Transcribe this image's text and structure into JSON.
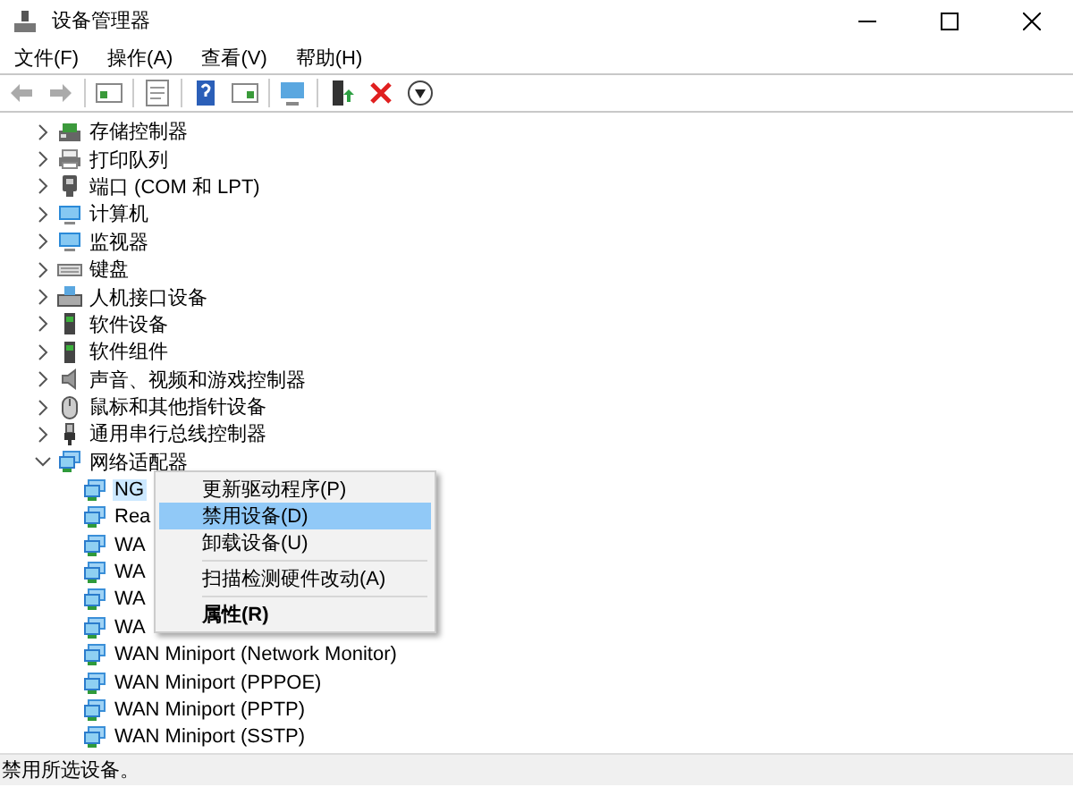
{
  "window": {
    "title": "设备管理器"
  },
  "menu": [
    "文件(F)",
    "操作(A)",
    "查看(V)",
    "帮助(H)"
  ],
  "tree": [
    {
      "label": "存储控制器",
      "kind": "storage",
      "expanded": false
    },
    {
      "label": "打印队列",
      "kind": "printer",
      "expanded": false
    },
    {
      "label": "端口 (COM 和 LPT)",
      "kind": "port",
      "expanded": false
    },
    {
      "label": "计算机",
      "kind": "computer",
      "expanded": false
    },
    {
      "label": "监视器",
      "kind": "computer",
      "expanded": false
    },
    {
      "label": "键盘",
      "kind": "keyboard",
      "expanded": false
    },
    {
      "label": "人机接口设备",
      "kind": "hid",
      "expanded": false
    },
    {
      "label": "软件设备",
      "kind": "software",
      "expanded": false
    },
    {
      "label": "软件组件",
      "kind": "software",
      "expanded": false
    },
    {
      "label": "声音、视频和游戏控制器",
      "kind": "sound",
      "expanded": false
    },
    {
      "label": "鼠标和其他指针设备",
      "kind": "mouse",
      "expanded": false
    },
    {
      "label": "通用串行总线控制器",
      "kind": "usb",
      "expanded": false
    },
    {
      "label": "网络适配器",
      "kind": "network",
      "expanded": true,
      "children": [
        {
          "label": "NG",
          "selected": true
        },
        {
          "label": "Rea",
          "selected": false
        },
        {
          "label": "WA",
          "selected": false
        },
        {
          "label": "WA",
          "selected": false
        },
        {
          "label": "WA",
          "selected": false
        },
        {
          "label": "WA",
          "selected": false
        },
        {
          "label": "WAN Miniport (Network Monitor)",
          "selected": false
        },
        {
          "label": "WAN Miniport (PPPOE)",
          "selected": false
        },
        {
          "label": "WAN Miniport (PPTP)",
          "selected": false
        },
        {
          "label": "WAN Miniport (SSTP)",
          "selected": false
        }
      ]
    }
  ],
  "context_menu": [
    {
      "kind": "item",
      "label": "更新驱动程序(P)",
      "selected": false
    },
    {
      "kind": "item",
      "label": "禁用设备(D)",
      "selected": true
    },
    {
      "kind": "item",
      "label": "卸载设备(U)",
      "selected": false
    },
    {
      "kind": "separator"
    },
    {
      "kind": "item",
      "label": "扫描检测硬件改动(A)",
      "selected": false
    },
    {
      "kind": "separator"
    },
    {
      "kind": "default",
      "label": "属性(R)",
      "selected": false
    }
  ],
  "status_bar": "禁用所选设备。"
}
